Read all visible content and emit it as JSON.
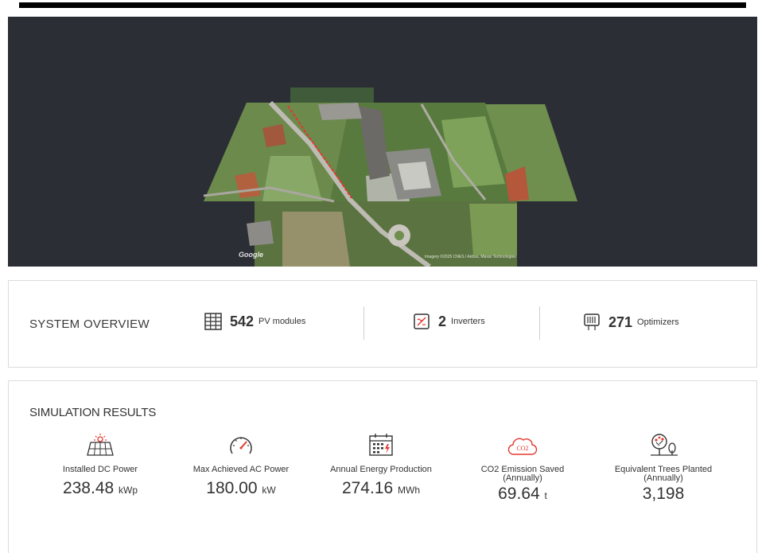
{
  "map": {
    "logo": "Google",
    "credit": "Imagery ©2025 CNES / Airbus, Maxar Technologies"
  },
  "overview": {
    "title": "SYSTEM OVERVIEW",
    "items": [
      {
        "icon": "grid-icon",
        "value": "542",
        "label": "PV modules"
      },
      {
        "icon": "inverter-icon",
        "value": "2",
        "label": "Inverters"
      },
      {
        "icon": "optimizer-icon",
        "value": "271",
        "label": "Optimizers"
      }
    ]
  },
  "results": {
    "title": "SIMULATION RESULTS",
    "metrics": [
      {
        "icon": "solar-panel-icon",
        "label": "Installed DC Power",
        "sub": "",
        "value": "238.48",
        "unit": "kWp"
      },
      {
        "icon": "speedometer-icon",
        "label": "Max Achieved AC Power",
        "sub": "",
        "value": "180.00",
        "unit": "kW"
      },
      {
        "icon": "calendar-icon",
        "label": "Annual Energy Production",
        "sub": "",
        "value": "274.16",
        "unit": "MWh"
      },
      {
        "icon": "co2-cloud-icon",
        "label": "CO2 Emission Saved",
        "sub": "(Annually)",
        "value": "69.64",
        "unit": "t"
      },
      {
        "icon": "trees-icon",
        "label": "Equivalent Trees Planted",
        "sub": "(Annually)",
        "value": "3,198",
        "unit": ""
      }
    ],
    "co2_icon_text": "CO2"
  },
  "colors": {
    "accent_red": "#e5382f",
    "map_bg": "#2c2e36",
    "text": "#333333"
  }
}
